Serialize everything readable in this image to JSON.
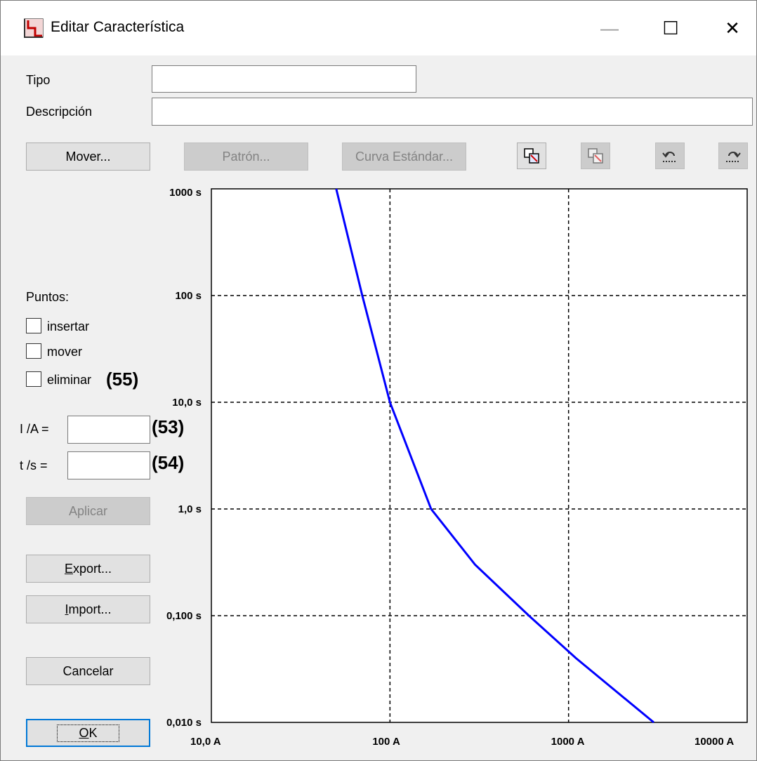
{
  "window": {
    "title": "Editar Característica",
    "minimize_glyph": "—",
    "maximize_glyph": "☐",
    "close_glyph": "✕"
  },
  "form": {
    "tipo_label": "Tipo",
    "tipo_value": "",
    "descripcion_label": "Descripción",
    "descripcion_value": ""
  },
  "toolbar": {
    "mover_label": "Mover...",
    "patron_label": "Patrón...",
    "curva_label": "Curva Estándar...",
    "icons": [
      "copy-curve-icon",
      "paste-curve-icon",
      "undo-icon",
      "redo-icon"
    ]
  },
  "points": {
    "header": "Puntos:",
    "insert_label": "insertar",
    "move_label": "mover",
    "delete_label": "eliminar",
    "delete_annotation": "(55)"
  },
  "coords": {
    "i_label": "I /A =",
    "i_value": "",
    "i_annotation": "(53)",
    "t_label": "t /s =",
    "t_value": "",
    "t_annotation": "(54)"
  },
  "buttons": {
    "apply_label": "Aplicar",
    "export_accel": "E",
    "export_rest": "xport...",
    "import_accel": "I",
    "import_rest": "mport...",
    "cancel_label": "Cancelar",
    "ok_accel": "O",
    "ok_rest": "K"
  },
  "chart_data": {
    "type": "line",
    "x_scale": "log",
    "y_scale": "log",
    "xlim": [
      10,
      10000
    ],
    "ylim": [
      0.01,
      1000
    ],
    "x_ticks": [
      10,
      100,
      1000,
      10000
    ],
    "x_tick_labels": [
      "10,0 A",
      "100 A",
      "1000 A",
      "10000 A"
    ],
    "y_ticks": [
      1000,
      100,
      10,
      1,
      0.1,
      0.01
    ],
    "y_tick_labels": [
      "1000 s",
      "100 s",
      "10,0 s",
      "1,0 s",
      "0,100 s",
      "0,010 s"
    ],
    "grid": "dashed",
    "line_color": "#0000ff",
    "series": [
      {
        "x": [
          50,
          70,
          100,
          170,
          300,
          600,
          1100,
          3000
        ],
        "y": [
          1000,
          100,
          10,
          1,
          0.3,
          0.1,
          0.04,
          0.01
        ]
      }
    ]
  }
}
